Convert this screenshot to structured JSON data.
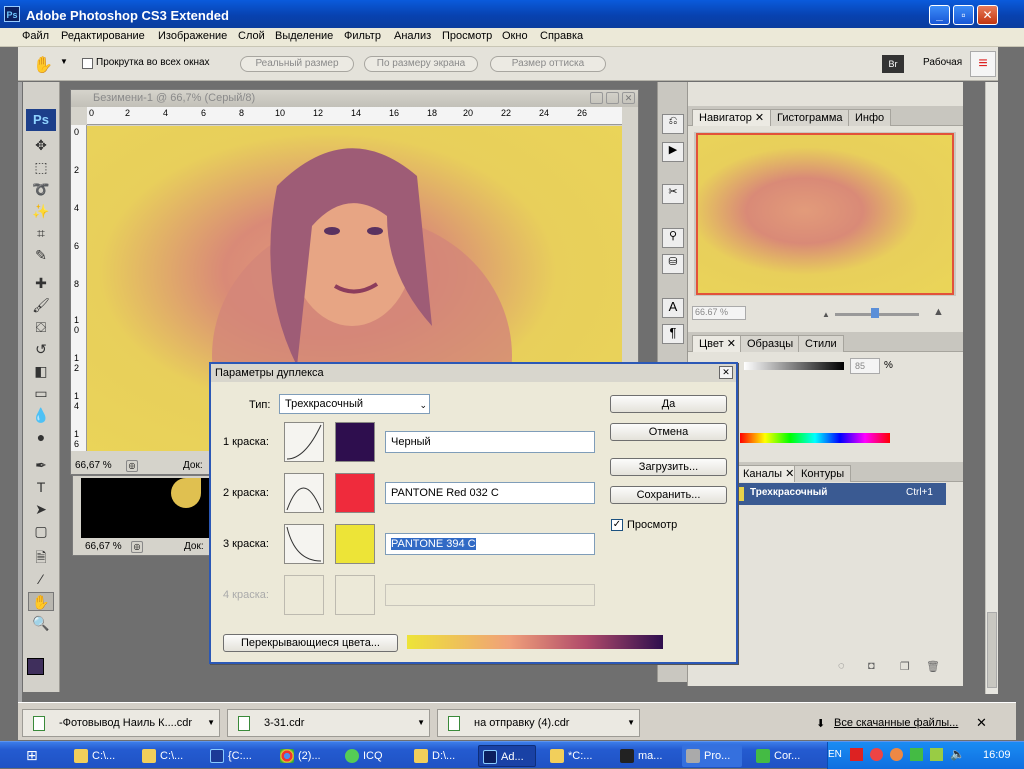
{
  "app": {
    "title": "Adobe Photoshop CS3 Extended",
    "icon": "Ps"
  },
  "menu": [
    "Файл",
    "Редактирование",
    "Изображение",
    "Слой",
    "Выделение",
    "Фильтр",
    "Анализ",
    "Просмотр",
    "Окно",
    "Справка"
  ],
  "options_bar": {
    "scroll_all_label": "Прокрутка во всех окнах",
    "actual_size": "Реальный размер",
    "fit_screen": "По размеру экрана",
    "print_size": "Размер оттиска",
    "workspace": "Рабочая"
  },
  "toolbox": {
    "logo": "Ps"
  },
  "document1": {
    "title": "Безимени-1 @ 66,7% (Серый/8)",
    "zoom": "66,67 %",
    "doc_label": "Док:",
    "ruler_h": [
      "0",
      "2",
      "4",
      "6",
      "8",
      "10",
      "12",
      "14",
      "16",
      "18",
      "20",
      "22",
      "24",
      "26"
    ],
    "ruler_v": [
      "0",
      "2",
      "4",
      "6",
      "8",
      "1 0",
      "1 2",
      "1 4",
      "1 6"
    ]
  },
  "document2": {
    "zoom": "66,67 %",
    "doc_label": "Док:"
  },
  "navigator": {
    "tabs": [
      "Навигатор",
      "Гистограмма",
      "Инфо"
    ],
    "zoom": "66.67 %"
  },
  "color_panel": {
    "tabs": [
      "Цвет",
      "Образцы",
      "Стили"
    ],
    "value": "85",
    "unit": "%"
  },
  "channels": {
    "tabs": [
      "Каналы",
      "Контуры"
    ],
    "row_name": "Трехкрасочный",
    "row_shortcut": "Ctrl+1"
  },
  "dialog": {
    "title": "Параметры дуплекса",
    "type_label": "Тип:",
    "type_value": "Трехкрасочный",
    "inks": [
      {
        "label": "1 краска:",
        "name": "Черный",
        "color": "#2e0e4e",
        "enabled": true
      },
      {
        "label": "2 краска:",
        "name": "PANTONE Red 032 C",
        "color": "#ef2b3c",
        "enabled": true
      },
      {
        "label": "3 краска:",
        "name": "PANTONE 394 C",
        "color": "#ede437",
        "enabled": true
      },
      {
        "label": "4 краска:",
        "name": "",
        "color": "#ece9d8",
        "enabled": false
      }
    ],
    "overprint_button": "Перекрывающиеся цвета...",
    "buttons": {
      "ok": "Да",
      "cancel": "Отмена",
      "load": "Загрузить...",
      "save": "Сохранить..."
    },
    "preview_label": "Просмотр",
    "preview_checked": true
  },
  "downloads": {
    "items": [
      "-Фотовывод Наиль К....cdr",
      "3-31.cdr",
      "на отправку (4).cdr"
    ],
    "all_label": "Все скачанные файлы..."
  },
  "taskbar": {
    "items": [
      "C:\\...",
      "C:\\...",
      "{C:...",
      "(2)...",
      "ICQ",
      "D:\\...",
      "Ad...",
      "*C:...",
      "ma...",
      "Pro...",
      "Cor..."
    ],
    "lang": "EN",
    "time": "16:09"
  },
  "colors": {
    "accent": "#0a5bdc",
    "canvas_yellow": "#ead558",
    "canvas_pink": "#e29b7a"
  }
}
